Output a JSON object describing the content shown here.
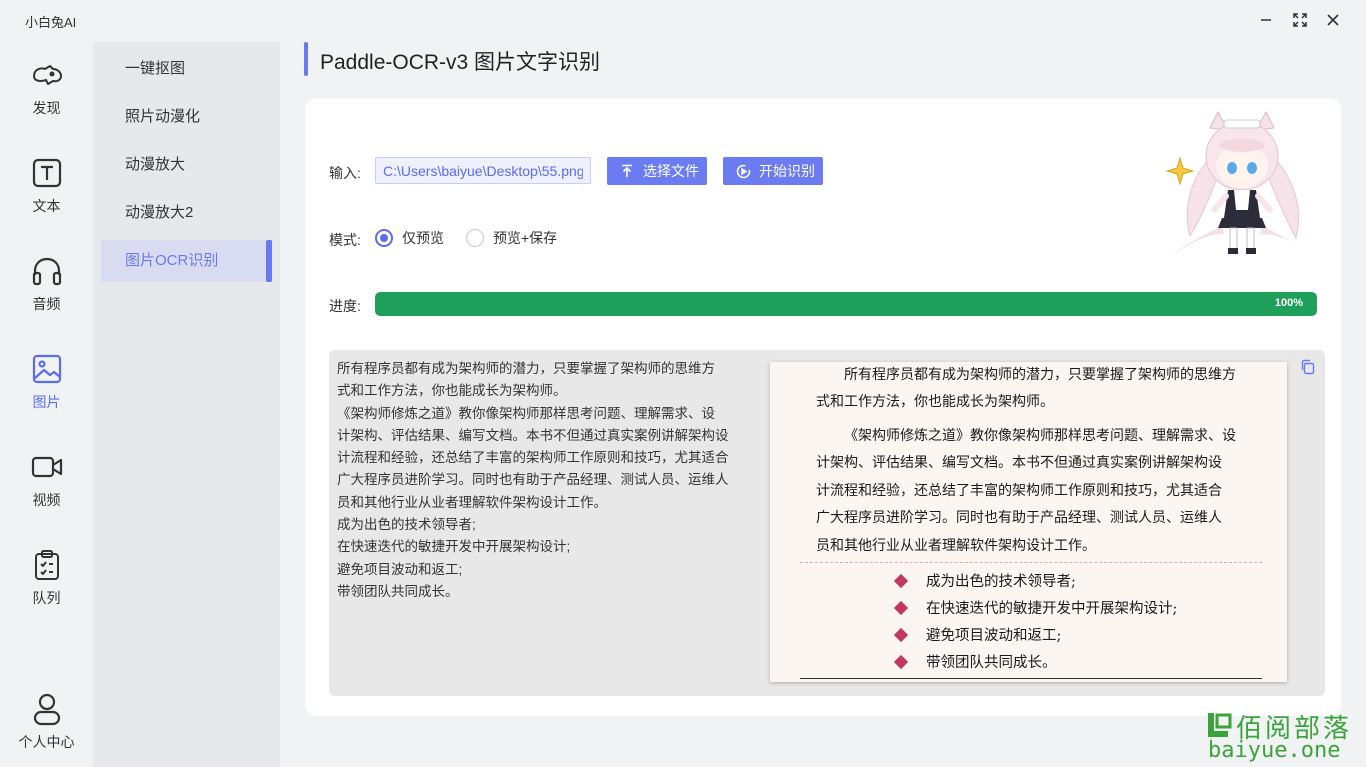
{
  "window": {
    "title": "小白兔AI"
  },
  "nav": {
    "items": [
      {
        "label": "发现",
        "icon": "discover-icon"
      },
      {
        "label": "文本",
        "icon": "text-icon"
      },
      {
        "label": "音频",
        "icon": "headphones-icon"
      },
      {
        "label": "图片",
        "icon": "image-icon"
      },
      {
        "label": "视频",
        "icon": "video-icon"
      },
      {
        "label": "队列",
        "icon": "clipboard-icon"
      }
    ],
    "user": {
      "label": "个人中心",
      "icon": "user-icon"
    },
    "active": "图片"
  },
  "submenu": {
    "items": [
      "一键抠图",
      "照片动漫化",
      "动漫放大",
      "动漫放大2",
      "图片OCR识别"
    ],
    "active": "图片OCR识别"
  },
  "page": {
    "title": "Paddle-OCR-v3 图片文字识别"
  },
  "input": {
    "label": "输入:",
    "value": "C:\\Users\\baiyue\\Desktop\\55.png",
    "select_button": "选择文件",
    "start_button": "开始识别"
  },
  "mode": {
    "label": "模式:",
    "options": [
      "仅预览",
      "预览+保存"
    ],
    "selected": "仅预览"
  },
  "progress": {
    "label": "进度:",
    "value": 100,
    "text": "100%"
  },
  "result": {
    "lines": [
      "所有程序员都有成为架构师的潜力，只要掌握了架构师的思维方",
      "式和工作方法，你也能成长为架构师。",
      "《架构师修炼之道》教你像架构师那样思考问题、理解需求、设",
      "计架构、评估结果、编写文档。本书不但通过真实案例讲解架构设",
      "计流程和经验，还总结了丰富的架构师工作原则和技巧，尤其适合",
      "广大程序员进阶学习。同时也有助于产品经理、测试人员、运维人",
      "员和其他行业从业者理解软件架构设计工作。",
      "成为出色的技术领导者;",
      "在快速迭代的敏捷开发中开展架构设计;",
      "避免项目波动和返工;",
      "带领团队共同成长。"
    ]
  },
  "preview": {
    "para1": [
      "所有程序员都有成为架构师的潜力，只要掌握了架构师的思维方",
      "式和工作方法，你也能成长为架构师。"
    ],
    "para2": [
      "《架构师修炼之道》教你像架构师那样思考问题、理解需求、设",
      "计架构、评估结果、编写文档。本书不但通过真实案例讲解架构设",
      "计流程和经验，还总结了丰富的架构师工作原则和技巧，尤其适合",
      "广大程序员进阶学习。同时也有助于产品经理、测试人员、运维人",
      "员和其他行业从业者理解软件架构设计工作。"
    ],
    "bullets": [
      "成为出色的技术领导者;",
      "在快速迭代的敏捷开发中开展架构设计;",
      "避免项目波动和返工;",
      "带领团队共同成长。"
    ]
  },
  "watermark": {
    "cn": "佰阅部落",
    "en": "baiyue.one"
  },
  "colors": {
    "accent": "#6a79ee",
    "progress": "#1fa05a",
    "bullet": "#c2365f"
  }
}
